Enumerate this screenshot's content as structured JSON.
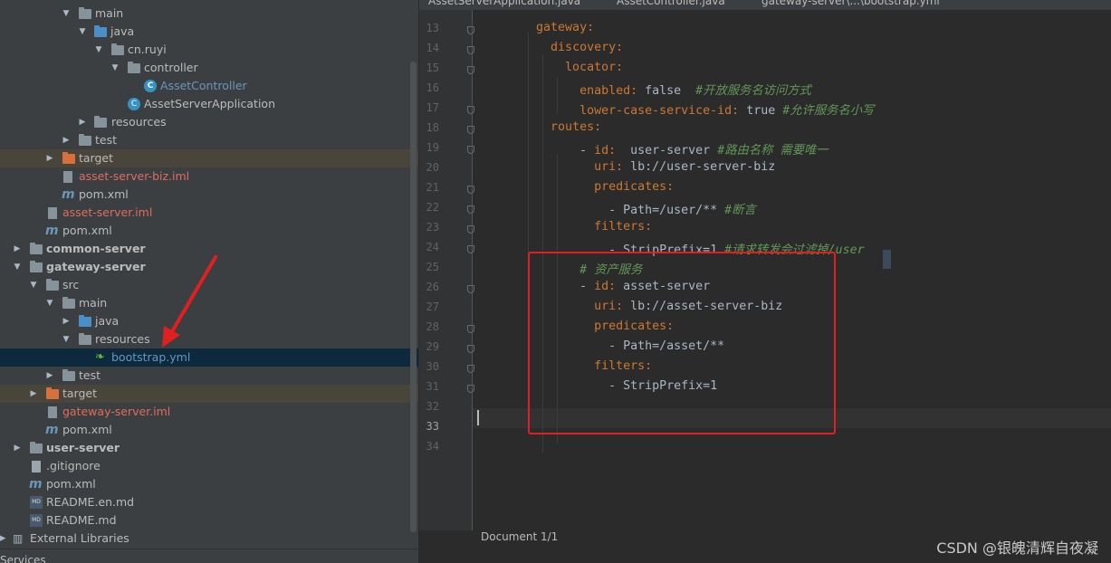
{
  "project_tree": {
    "rows": [
      {
        "label": "main"
      },
      {
        "label": "java"
      },
      {
        "label": "cn.ruyi"
      },
      {
        "label": "controller"
      },
      {
        "label": "AssetController"
      },
      {
        "label": "AssetServerApplication"
      },
      {
        "label": "resources"
      },
      {
        "label": "test"
      },
      {
        "label": "target"
      },
      {
        "label": "asset-server-biz.iml"
      },
      {
        "label": "pom.xml"
      },
      {
        "label": "asset-server.iml"
      },
      {
        "label": "pom.xml"
      },
      {
        "label": "common-server"
      },
      {
        "label": "gateway-server"
      },
      {
        "label": "src"
      },
      {
        "label": "main"
      },
      {
        "label": "java"
      },
      {
        "label": "resources"
      },
      {
        "label": "bootstrap.yml"
      },
      {
        "label": "test"
      },
      {
        "label": "target"
      },
      {
        "label": "gateway-server.iml"
      },
      {
        "label": "pom.xml"
      },
      {
        "label": "user-server"
      },
      {
        "label": ".gitignore"
      },
      {
        "label": "pom.xml"
      },
      {
        "label": "README.en.md"
      },
      {
        "label": "README.md"
      },
      {
        "label": "External Libraries"
      }
    ],
    "services_label": "Services"
  },
  "editor": {
    "tabs": [
      {
        "label": "AssetServerApplication.java"
      },
      {
        "label": "AssetController.java"
      },
      {
        "label": "gateway-server\\...\\bootstrap.yml"
      }
    ],
    "lines": [
      {
        "n": "13",
        "t": "    gateway:"
      },
      {
        "n": "14",
        "t": "      discovery:"
      },
      {
        "n": "15",
        "t": "        locator:"
      },
      {
        "n": "16",
        "t": "          enabled: false  #开放服务名访问方式"
      },
      {
        "n": "17",
        "t": "          lower-case-service-id: true #允许服务名小写"
      },
      {
        "n": "18",
        "t": "      routes:"
      },
      {
        "n": "19",
        "t": "          - id:  user-server #路由名称 需要唯一"
      },
      {
        "n": "20",
        "t": "            uri: lb://user-server-biz"
      },
      {
        "n": "21",
        "t": "            predicates:"
      },
      {
        "n": "22",
        "t": "              - Path=/user/** #断言"
      },
      {
        "n": "23",
        "t": "            filters:"
      },
      {
        "n": "24",
        "t": "              - StripPrefix=1 #请求转发会过滤掉/user"
      },
      {
        "n": "25",
        "t": "          # 资产服务"
      },
      {
        "n": "26",
        "t": "          - id: asset-server"
      },
      {
        "n": "27",
        "t": "            uri: lb://asset-server-biz"
      },
      {
        "n": "28",
        "t": "            predicates:"
      },
      {
        "n": "29",
        "t": "              - Path=/asset/**"
      },
      {
        "n": "30",
        "t": "            filters:"
      },
      {
        "n": "31",
        "t": "              - StripPrefix=1"
      },
      {
        "n": "32",
        "t": ""
      },
      {
        "n": "33",
        "t": ""
      },
      {
        "n": "34",
        "t": ""
      }
    ],
    "status": "Document 1/1"
  },
  "watermark": "CSDN @银魄清辉自夜凝",
  "colors": {
    "keyword": "#cc7832",
    "comment": "#629755",
    "text": "#a9b7c6",
    "highlight_box": "#e02020"
  }
}
